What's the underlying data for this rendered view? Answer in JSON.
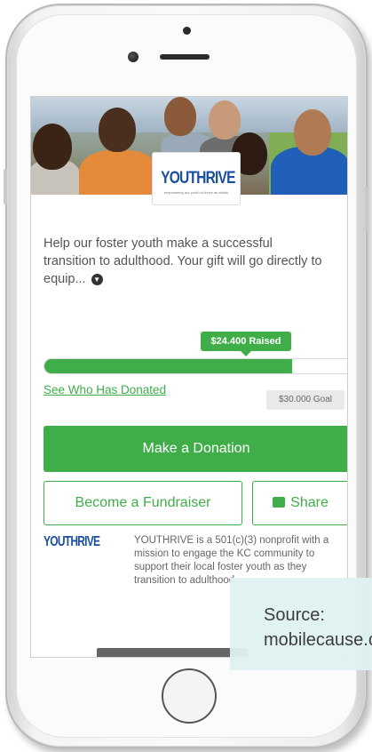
{
  "hero": {
    "brand_name": "YOUTHRIVE",
    "brand_tagline": "empowering our youth to thrive as adults"
  },
  "campaign": {
    "intro": "Help our foster youth make a successful transition to adulthood. Your gift will go directly to equip...",
    "expand_icon": "chevron-down-icon",
    "raised_label": "$24.400 Raised",
    "raised_amount": 24400,
    "goal_label": "$30.000 Goal",
    "goal_amount": 30000,
    "progress_fraction": 0.8133,
    "donors_link": "See Who Has Donated"
  },
  "actions": {
    "donate_label": "Make a Donation",
    "fundraiser_label": "Become a Fundraiser",
    "share_label": "Share",
    "share_icon": "share-icon"
  },
  "about": {
    "brand_name": "YOUTHRIVE",
    "text": "YOUTHRIVE is a 501(c)(3) nonprofit with a mission to engage the KC community to support their local foster youth as they transition to adulthood."
  },
  "source": {
    "label": "Source:",
    "value": "mobilecause.com"
  },
  "colors": {
    "accent": "#3fae49",
    "brand_blue": "#1a4fa0",
    "caption_bg": "#dff2f1"
  }
}
